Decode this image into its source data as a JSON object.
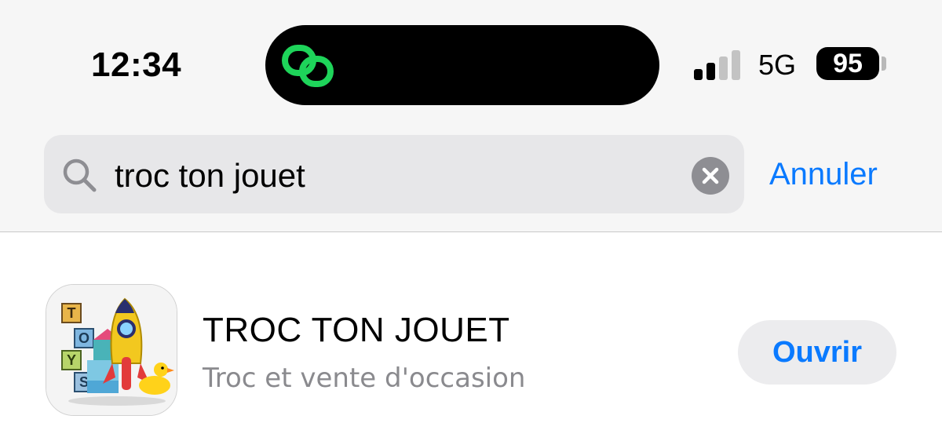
{
  "status_bar": {
    "time": "12:34",
    "network": "5G",
    "battery_level": "95",
    "signal_bars_active": 2,
    "signal_bars_total": 4
  },
  "search": {
    "query": "troc ton jouet",
    "cancel_label": "Annuler",
    "clear_icon": "xmark-circle-icon",
    "search_icon": "magnifying-glass-icon"
  },
  "results": [
    {
      "title": "TROC TON JOUET",
      "subtitle": "Troc et vente d'occasion",
      "action_label": "Ouvrir",
      "icon": "toy-rocket-app-icon",
      "icon_letters": [
        "T",
        "O",
        "Y",
        "S"
      ]
    }
  ],
  "colors": {
    "accent": "#0a7aff",
    "island_link_icon": "#1ed45a",
    "search_field_bg": "#e7e7e9",
    "button_bg": "#ececee"
  }
}
